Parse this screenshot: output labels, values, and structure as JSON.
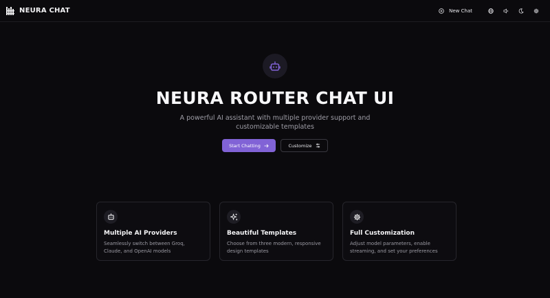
{
  "header": {
    "brand_name": "NEURA CHAT",
    "new_chat_label": "New Chat",
    "icons": [
      "plus-circle-icon",
      "globe-icon",
      "speaker-icon",
      "moon-icon",
      "gear-icon"
    ]
  },
  "hero": {
    "title": "NEURA ROUTER CHAT UI",
    "subtitle": "A powerful AI assistant with multiple provider support and customizable templates",
    "start_label": "Start Chatting",
    "customize_label": "Customize"
  },
  "features": [
    {
      "icon": "robot-icon",
      "title": "Multiple AI Providers",
      "description": "Seamlessly switch between Groq, Claude, and OpenAI models"
    },
    {
      "icon": "sparkles-icon",
      "title": "Beautiful Templates",
      "description": "Choose from three modern, responsive design templates"
    },
    {
      "icon": "gear-icon",
      "title": "Full Customization",
      "description": "Adjust model parameters, enable streaming, and set your preferences"
    }
  ],
  "colors": {
    "background": "#0b0a0d",
    "accent": "#8163d6",
    "muted_text": "#a09fa8"
  }
}
